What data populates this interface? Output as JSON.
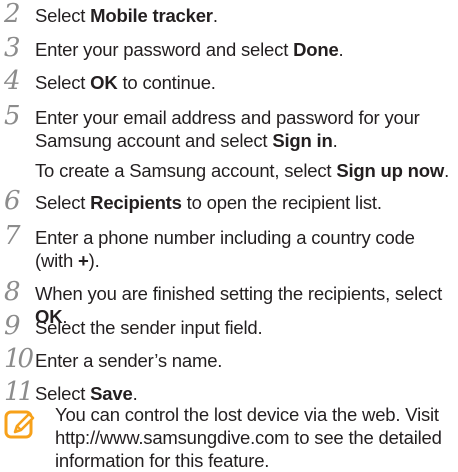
{
  "steps": [
    {
      "num": "2",
      "parts": [
        {
          "t": "Select "
        },
        {
          "t": "Mobile tracker",
          "b": true
        },
        {
          "t": "."
        }
      ]
    },
    {
      "num": "3",
      "parts": [
        {
          "t": "Enter your password and select "
        },
        {
          "t": "Done",
          "b": true
        },
        {
          "t": "."
        }
      ]
    },
    {
      "num": "4",
      "parts": [
        {
          "t": "Select "
        },
        {
          "t": "OK",
          "b": true
        },
        {
          "t": " to continue."
        }
      ]
    },
    {
      "num": "5",
      "line1": "Enter your email address and password for your",
      "parts": [
        {
          "t": "Samsung account and select "
        },
        {
          "t": "Sign in",
          "b": true
        },
        {
          "t": "."
        }
      ],
      "sub": [
        {
          "t": "To create a Samsung account, select "
        },
        {
          "t": "Sign up now",
          "b": true
        },
        {
          "t": "."
        }
      ]
    },
    {
      "num": "6",
      "parts": [
        {
          "t": "Select "
        },
        {
          "t": "Recipients",
          "b": true
        },
        {
          "t": " to open the recipient list."
        }
      ]
    },
    {
      "num": "7",
      "line1": "Enter a phone number including a country code",
      "parts": [
        {
          "t": "(with "
        },
        {
          "t": "+",
          "b": true
        },
        {
          "t": ")."
        }
      ]
    },
    {
      "num": "8",
      "parts": [
        {
          "t": "When you are finished setting the recipients, select "
        },
        {
          "t": "OK",
          "b": true
        },
        {
          "t": "."
        }
      ]
    },
    {
      "num": "9",
      "parts": [
        {
          "t": "Select the sender input field."
        }
      ]
    },
    {
      "num": "10",
      "parts": [
        {
          "t": "Enter a sender’s name."
        }
      ]
    },
    {
      "num": "11",
      "parts": [
        {
          "t": "Select "
        },
        {
          "t": "Save",
          "b": true
        },
        {
          "t": "."
        }
      ]
    }
  ],
  "note": {
    "icon": "note-pencil-icon",
    "lines": [
      "You can control the lost device via the web. Visit",
      "http://www.samsungdive.com to see the detailed",
      "information for this feature."
    ]
  },
  "colors": {
    "accent": "#f7a11a",
    "text": "#231f20",
    "step_number": "#8c8c8c"
  }
}
